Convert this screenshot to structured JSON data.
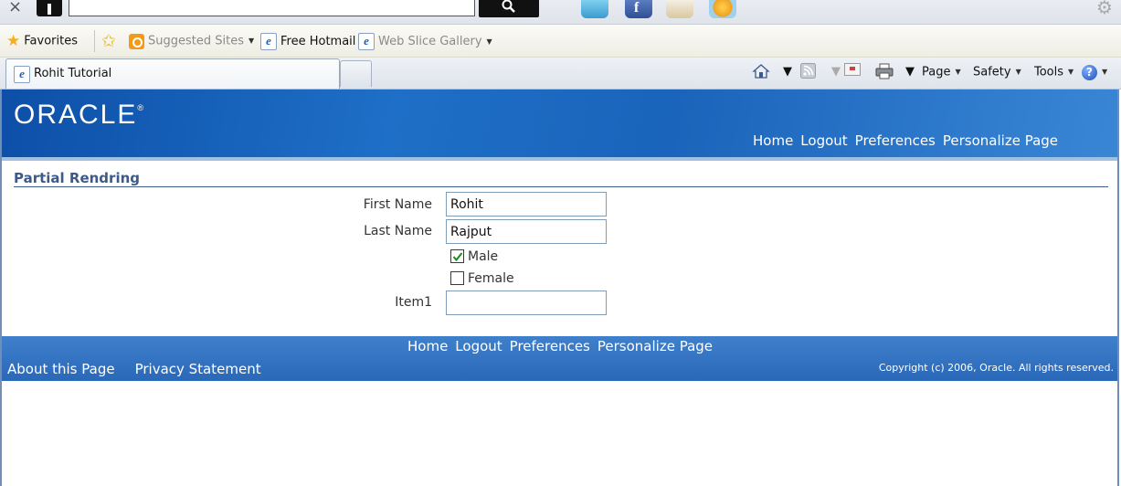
{
  "browser": {
    "favorites_label": "Favorites",
    "suggested_sites": "Suggested Sites",
    "free_hotmail": "Free Hotmail",
    "web_slice_gallery": "Web Slice Gallery",
    "tab_title": "Rohit Tutorial",
    "commands": {
      "page": "Page",
      "safety": "Safety",
      "tools": "Tools"
    }
  },
  "brand": {
    "logo_text": "ORACLE",
    "logo_mark": "®"
  },
  "header_links": [
    "Home",
    "Logout",
    "Preferences",
    "Personalize Page"
  ],
  "section": {
    "title": "Partial Rendring"
  },
  "form": {
    "first_name": {
      "label": "First Name",
      "value": "Rohit"
    },
    "last_name": {
      "label": "Last Name",
      "value": "Rajput"
    },
    "male": {
      "label": "Male",
      "checked": true
    },
    "female": {
      "label": "Female",
      "checked": false
    },
    "item1": {
      "label": "Item1",
      "value": ""
    }
  },
  "footer": {
    "links": [
      "Home",
      "Logout",
      "Preferences",
      "Personalize Page"
    ],
    "about": "About this Page",
    "privacy": "Privacy Statement",
    "copyright": "Copyright (c) 2006, Oracle. All rights reserved."
  },
  "colors": {
    "header_blue": "#1e6fc7",
    "section_title": "#3c5a8a",
    "footer_blue": "#2a68b8"
  }
}
